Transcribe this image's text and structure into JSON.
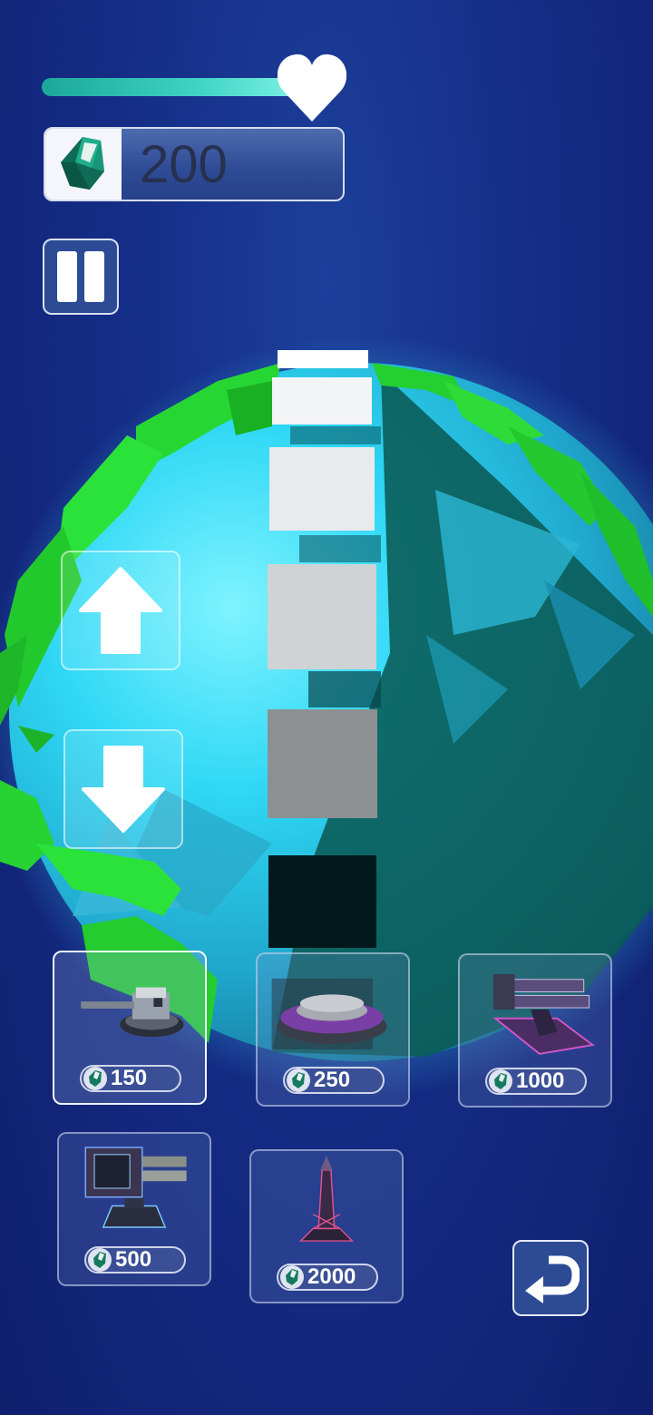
{
  "hud": {
    "health_fraction": 0.86,
    "currency_amount": "200",
    "icons": {
      "health": "heart-icon",
      "currency": "crystal-gem-icon",
      "pause": "pause-icon"
    }
  },
  "controls": {
    "up_icon": "arrow-up-icon",
    "down_icon": "arrow-down-icon",
    "back_icon": "return-arrow-icon"
  },
  "shop": {
    "items": [
      {
        "name": "gun-turret",
        "price": "150",
        "selected": true
      },
      {
        "name": "disc-turret",
        "price": "250",
        "selected": false
      },
      {
        "name": "rail-cannon",
        "price": "1000",
        "selected": false
      },
      {
        "name": "missile-launcher",
        "price": "500",
        "selected": false
      },
      {
        "name": "laser-tower",
        "price": "2000",
        "selected": false
      }
    ]
  },
  "colors": {
    "background": "#152d86",
    "planet_ocean": "#2ec9ee",
    "planet_land": "#27d42e",
    "health_bar": "#3fd4c4",
    "currency_panel": "#2f4c96"
  }
}
